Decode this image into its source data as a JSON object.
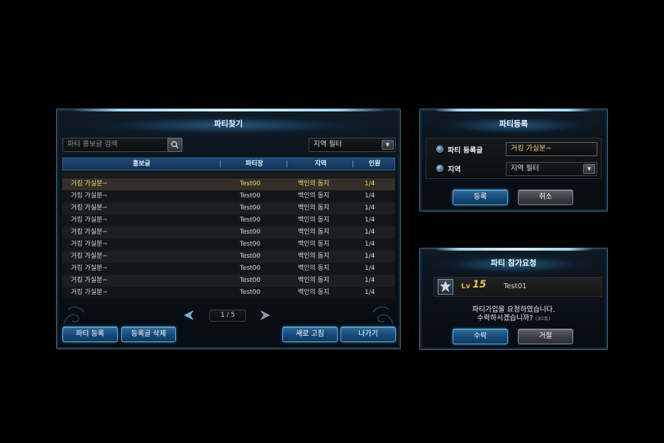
{
  "party_find": {
    "title": "파티찾기",
    "search_placeholder": "파티 홍보글 검색",
    "region_filter": "지역 필터",
    "columns": [
      "홍보글",
      "파티장",
      "지역",
      "인원"
    ],
    "rows": [
      {
        "post": "거킹 가실분~",
        "leader": "Test00",
        "region": "백인의 동지",
        "members": "1/4"
      },
      {
        "post": "거킹 가실분~",
        "leader": "Test00",
        "region": "백인의 동지",
        "members": "1/4"
      },
      {
        "post": "거킹 가실분~",
        "leader": "Test00",
        "region": "백인의 동지",
        "members": "1/4"
      },
      {
        "post": "거킹 가실분~",
        "leader": "Test00",
        "region": "백인의 동지",
        "members": "1/4"
      },
      {
        "post": "거킹 가실분~",
        "leader": "Test00",
        "region": "백인의 동지",
        "members": "1/4"
      },
      {
        "post": "거킹 가실분~",
        "leader": "Test00",
        "region": "백인의 동지",
        "members": "1/4"
      },
      {
        "post": "거킹 가실분~",
        "leader": "Test00",
        "region": "백인의 동지",
        "members": "1/4"
      },
      {
        "post": "거킹 가실분~",
        "leader": "Test00",
        "region": "백인의 동지",
        "members": "1/4"
      },
      {
        "post": "거킹 가실분~",
        "leader": "Test00",
        "region": "백인의 동지",
        "members": "1/4"
      },
      {
        "post": "거킹 가실분~",
        "leader": "Test00",
        "region": "백인의 동지",
        "members": "1/4"
      }
    ],
    "page": "1 / 5",
    "buttons": {
      "register": "파티 등록",
      "delete": "등록글 삭제",
      "refresh": "새로 고침",
      "exit": "나가기"
    }
  },
  "party_register": {
    "title": "파티등록",
    "post_label": "파티 등록글",
    "post_value": "거킹 가실분~",
    "region_label": "지역",
    "region_value": "지역 필터",
    "confirm": "등록",
    "cancel": "취소"
  },
  "join_request": {
    "title": "파티 참가요청",
    "lv_label": "Lv",
    "level": "15",
    "player": "Test01",
    "message_line1": "파티가입을 요청하였습니다.",
    "message_line2": "수락하시겠습니까?",
    "timer": "(30초)",
    "accept": "수락",
    "reject": "거절"
  }
}
